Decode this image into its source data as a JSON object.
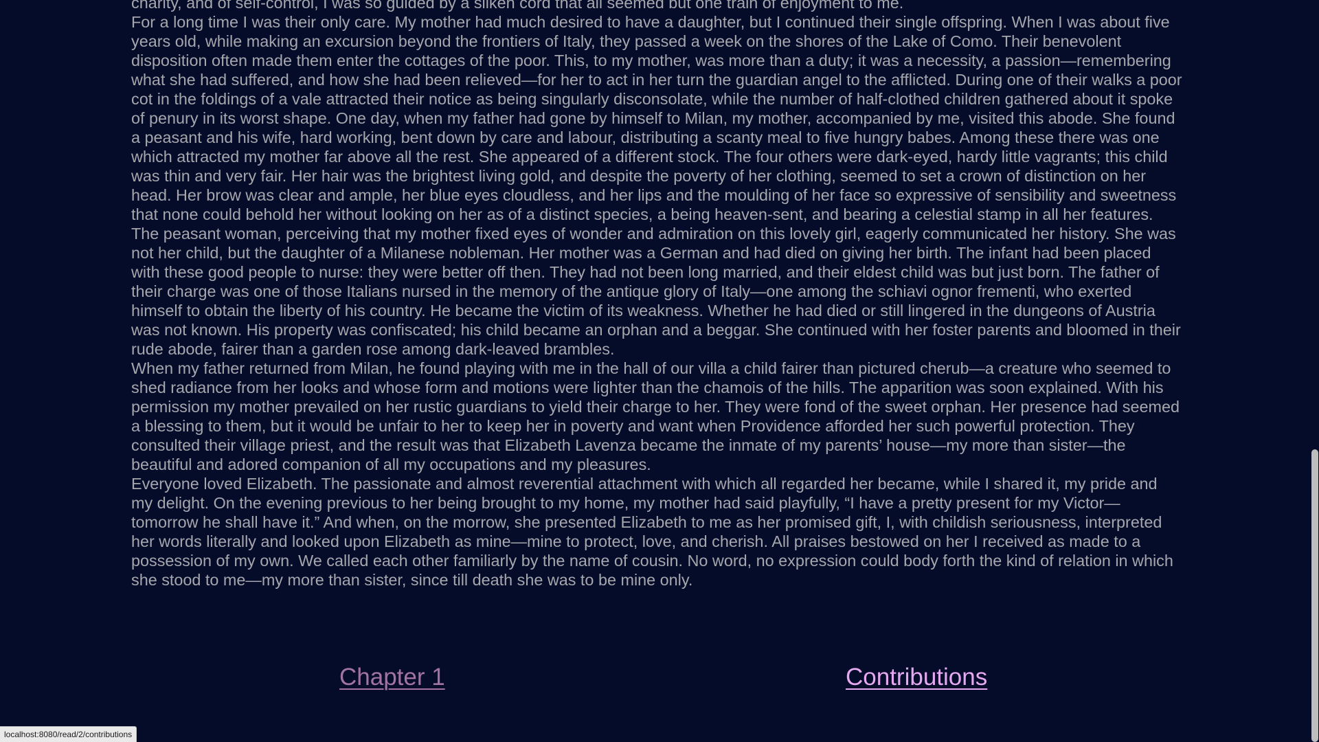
{
  "chapter_text": {
    "paragraphs": [
      "charity, and of self-control, I was so guided by a silken cord that all seemed but one train of enjoyment to me.",
      "For a long time I was their only care. My mother had much desired to have a daughter, but I continued their single offspring. When I was about five years old, while making an excursion beyond the frontiers of Italy, they passed a week on the shores of the Lake of Como. Their benevolent disposition often made them enter the cottages of the poor. This, to my mother, was more than a duty; it was a necessity, a passion—remembering what she had suffered, and how she had been relieved—for her to act in her turn the guardian angel to the afflicted. During one of their walks a poor cot in the foldings of a vale attracted their notice as being singularly disconsolate, while the number of half-clothed children gathered about it spoke of penury in its worst shape. One day, when my father had gone by himself to Milan, my mother, accompanied by me, visited this abode. She found a peasant and his wife, hard working, bent down by care and labour, distributing a scanty meal to five hungry babes. Among these there was one which attracted my mother far above all the rest. She appeared of a different stock. The four others were dark-eyed, hardy little vagrants; this child was thin and very fair. Her hair was the brightest living gold, and despite the poverty of her clothing, seemed to set a crown of distinction on her head. Her brow was clear and ample, her blue eyes cloudless, and her lips and the moulding of her face so expressive of sensibility and sweetness that none could behold her without looking on her as of a distinct species, a being heaven-sent, and bearing a celestial stamp in all her features.",
      "The peasant woman, perceiving that my mother fixed eyes of wonder and admiration on this lovely girl, eagerly communicated her history. She was not her child, but the daughter of a Milanese nobleman. Her mother was a German and had died on giving her birth. The infant had been placed with these good people to nurse: they were better off then. They had not been long married, and their eldest child was but just born. The father of their charge was one of those Italians nursed in the memory of the antique glory of Italy—one among the schiavi ognor frementi, who exerted himself to obtain the liberty of his country. He became the victim of its weakness. Whether he had died or still lingered in the dungeons of Austria was not known. His property was confiscated; his child became an orphan and a beggar. She continued with her foster parents and bloomed in their rude abode, fairer than a garden rose among dark-leaved brambles.",
      "When my father returned from Milan, he found playing with me in the hall of our villa a child fairer than pictured cherub—a creature who seemed to shed radiance from her looks and whose form and motions were lighter than the chamois of the hills. The apparition was soon explained. With his permission my mother prevailed on her rustic guardians to yield their charge to her. They were fond of the sweet orphan. Her presence had seemed a blessing to them, but it would be unfair to her to keep her in poverty and want when Providence afforded her such powerful protection. They consulted their village priest, and the result was that Elizabeth Lavenza became the inmate of my parents’ house—my more than sister—the beautiful and adored companion of all my occupations and my pleasures.",
      "Everyone loved Elizabeth. The passionate and almost reverential attachment with which all regarded her became, while I shared it, my pride and my delight. On the evening previous to her being brought to my home, my mother had said playfully, “I have a pretty present for my Victor—tomorrow he shall have it.” And when, on the morrow, she presented Elizabeth to me as her promised gift, I, with childish seriousness, interpreted her words literally and looked upon Elizabeth as mine—mine to protect, love, and cherish. All praises bestowed on her I received as made to a possession of my own. We called each other familiarly by the name of cousin. No word, no expression could body forth the kind of relation in which she stood to me—my more than sister, since till death she was to be mine only."
    ]
  },
  "nav": {
    "prev_label": "Chapter 1",
    "next_label": "Contributions"
  },
  "status_bar": {
    "url": "localhost:8080/read/2/contributions"
  },
  "colors": {
    "background": "#050c2a",
    "body_text": "#a6a7ad",
    "visited_link": "#a374a1",
    "hovered_link": "#e6a8f1"
  }
}
